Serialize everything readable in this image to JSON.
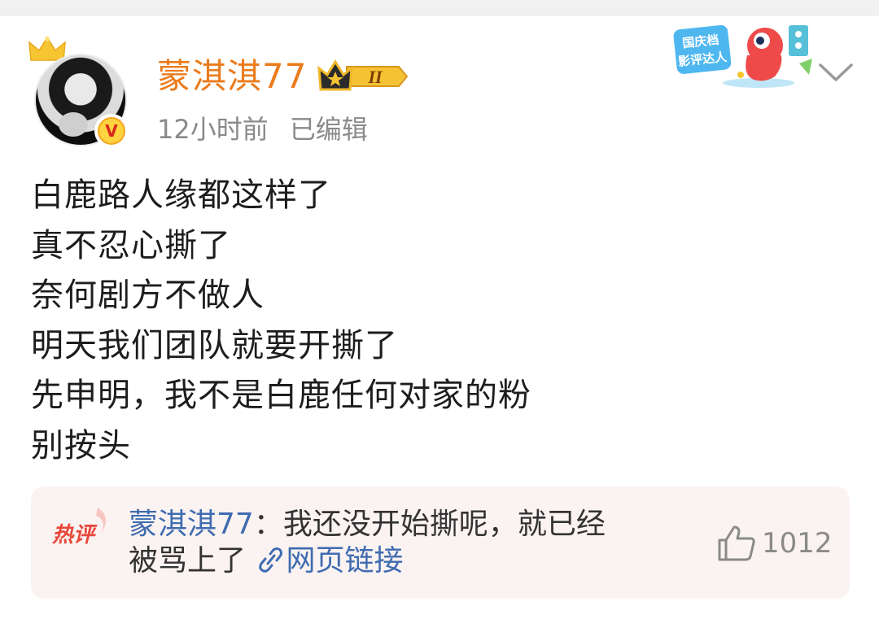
{
  "post": {
    "author": "蒙淇淇77",
    "member_level": "II",
    "time": "12小时前",
    "edited": "已编辑",
    "lines": [
      "白鹿路人缘都这样了",
      "真不忍心撕了",
      "奈何剧方不做人",
      "明天我们团队就要开撕了",
      "先申明，我不是白鹿任何对家的粉",
      "别按头"
    ]
  },
  "sticker": {
    "line1": "国庆档",
    "line2": "影评达人"
  },
  "hot_comment": {
    "tag": "热评",
    "user": "蒙淇淇77",
    "separator": "：",
    "text_line1": "我还没开始撕呢，就已经",
    "text_line2": "被骂上了",
    "link_label": "网页链接",
    "likes": "1012"
  },
  "colors": {
    "username": "#eb7b1c",
    "link": "#3f6bb0",
    "hot_tag": "#e8473a",
    "card_bg": "#fbf3f2"
  },
  "icons": [
    "crown-icon",
    "verified-icon",
    "member-crown-icon",
    "chevron-down-icon",
    "link-icon",
    "thumbs-up-icon"
  ]
}
